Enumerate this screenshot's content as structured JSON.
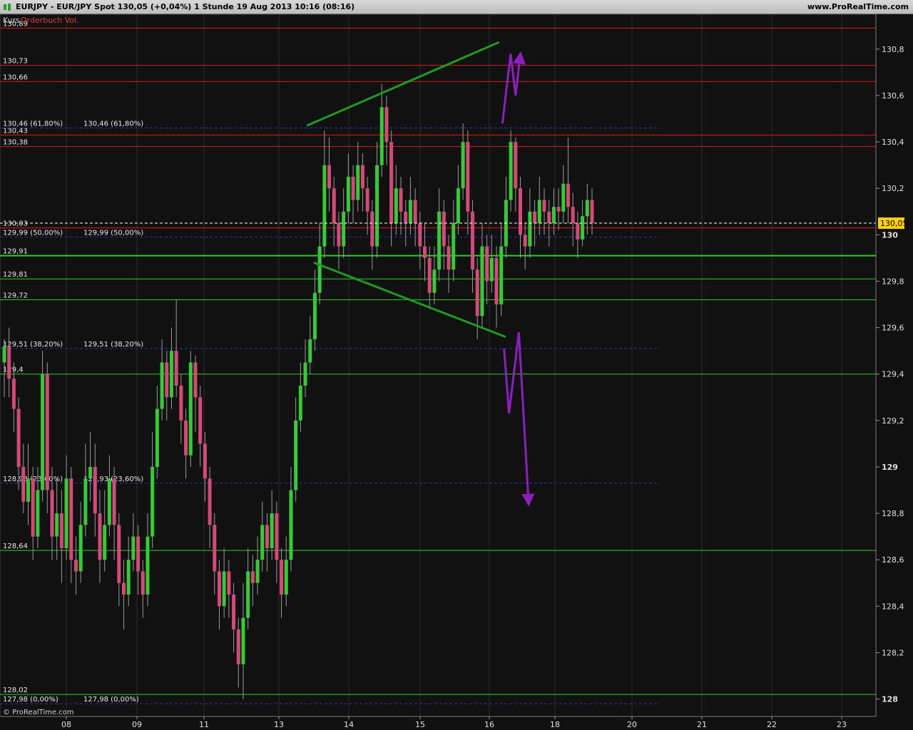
{
  "window": {
    "title": "EURJPY - EUR/JPY Spot     130,05 (+0,04%)     1 Stunde   19 Aug 2013 10:16 (08:16)",
    "site": "www.ProRealTime.com",
    "copyright": "© ProRealTime.com"
  },
  "legend": {
    "kurs": "Kurs",
    "orderbuch": "Orderbuch Vol."
  },
  "colors": {
    "background": "#111111",
    "bull_candle": "#33cc33",
    "bear_candle": "#d6487a",
    "resistance": "#d91c1c",
    "support": "#2dcc2d",
    "fib": "#2a35b8",
    "trend": "#1f9a1f",
    "forecast": "#8b1fc0",
    "price_badge": "#ffd000"
  },
  "chart_data": {
    "type": "candlestick",
    "symbol": "EURJPY",
    "timeframe": "1 Stunde",
    "last_price": 130.05,
    "last_price_label": "130,05",
    "change_pct": "+0,04%",
    "ylim": [
      127.925,
      130.95
    ],
    "y_ticks": [
      {
        "v": 130.8,
        "label": "130,8"
      },
      {
        "v": 130.6,
        "label": "130,6"
      },
      {
        "v": 130.4,
        "label": "130,4"
      },
      {
        "v": 130.2,
        "label": "130,2"
      },
      {
        "v": 130.0,
        "label": "130",
        "bold": true
      },
      {
        "v": 129.8,
        "label": "129,8"
      },
      {
        "v": 129.6,
        "label": "129,6"
      },
      {
        "v": 129.4,
        "label": "129,4"
      },
      {
        "v": 129.2,
        "label": "129,2"
      },
      {
        "v": 129.0,
        "label": "129",
        "bold": true
      },
      {
        "v": 128.8,
        "label": "128,8"
      },
      {
        "v": 128.6,
        "label": "128,6"
      },
      {
        "v": 128.4,
        "label": "128,4"
      },
      {
        "v": 128.2,
        "label": "128,2"
      },
      {
        "v": 128.0,
        "label": "128",
        "bold": true
      }
    ],
    "x_ticks": [
      "08",
      "09",
      "11",
      "13",
      "14",
      "15",
      "16",
      "18",
      "20",
      "21",
      "22",
      "23"
    ],
    "horizontal_levels": [
      {
        "value": 130.89,
        "label": "130,89",
        "kind": "resistance"
      },
      {
        "value": 130.73,
        "label": "130,73",
        "kind": "resistance"
      },
      {
        "value": 130.66,
        "label": "130,66",
        "kind": "resistance"
      },
      {
        "value": 130.43,
        "label": "130,43",
        "kind": "resistance"
      },
      {
        "value": 130.38,
        "label": "130,38",
        "kind": "resistance"
      },
      {
        "value": 130.03,
        "label": "130,03",
        "kind": "resistance"
      },
      {
        "value": 129.91,
        "label": "129,91",
        "kind": "support",
        "bold": true
      },
      {
        "value": 129.81,
        "label": "129,81",
        "kind": "support"
      },
      {
        "value": 129.72,
        "label": "129,72",
        "kind": "support"
      },
      {
        "value": 129.4,
        "label": "129,4",
        "kind": "support"
      },
      {
        "value": 128.64,
        "label": "128,64",
        "kind": "support"
      },
      {
        "value": 128.02,
        "label": "128,02",
        "kind": "support"
      }
    ],
    "fibonacci": [
      {
        "value": 130.46,
        "label": "130,46 (61,80%)"
      },
      {
        "value": 129.99,
        "label": "129,99 (50,00%)"
      },
      {
        "value": 129.51,
        "label": "129,51 (38,20%)"
      },
      {
        "value": 128.93,
        "label": "128,93 (23,60%)"
      },
      {
        "value": 127.98,
        "label": "127,98 (0,00%)"
      }
    ],
    "candles": [
      [
        129.45,
        129.52,
        129.55,
        129.3
      ],
      [
        129.52,
        129.38,
        129.6,
        129.3
      ],
      [
        129.38,
        129.25,
        129.45,
        129.15
      ],
      [
        129.25,
        129.0,
        129.3,
        128.9
      ],
      [
        129.0,
        128.85,
        129.1,
        128.8
      ],
      [
        128.85,
        128.95,
        129.1,
        128.75
      ],
      [
        128.95,
        128.7,
        129.0,
        128.6
      ],
      [
        128.7,
        128.9,
        129.0,
        128.65
      ],
      [
        128.9,
        129.4,
        129.5,
        128.85
      ],
      [
        129.4,
        128.9,
        129.45,
        128.8
      ],
      [
        128.9,
        128.7,
        129.0,
        128.6
      ],
      [
        128.7,
        128.8,
        128.95,
        128.6
      ],
      [
        128.8,
        128.65,
        128.9,
        128.5
      ],
      [
        128.65,
        128.95,
        129.05,
        128.6
      ],
      [
        128.95,
        128.6,
        129.0,
        128.5
      ],
      [
        128.6,
        128.55,
        128.7,
        128.45
      ],
      [
        128.55,
        128.75,
        128.85,
        128.5
      ],
      [
        128.75,
        128.95,
        129.1,
        128.7
      ],
      [
        128.95,
        129.0,
        129.15,
        128.85
      ],
      [
        129.0,
        128.8,
        129.1,
        128.7
      ],
      [
        128.8,
        128.6,
        128.9,
        128.5
      ],
      [
        128.6,
        128.75,
        128.9,
        128.55
      ],
      [
        128.75,
        128.95,
        129.05,
        128.7
      ],
      [
        128.95,
        128.75,
        129.0,
        128.6
      ],
      [
        128.75,
        128.5,
        128.8,
        128.4
      ],
      [
        128.5,
        128.45,
        128.6,
        128.3
      ],
      [
        128.45,
        128.6,
        128.7,
        128.4
      ],
      [
        128.6,
        128.7,
        128.8,
        128.55
      ],
      [
        128.7,
        128.55,
        128.75,
        128.45
      ],
      [
        128.55,
        128.45,
        128.6,
        128.35
      ],
      [
        128.45,
        128.7,
        128.8,
        128.4
      ],
      [
        128.7,
        129.0,
        129.15,
        128.65
      ],
      [
        129.0,
        129.25,
        129.35,
        128.95
      ],
      [
        129.25,
        129.45,
        129.55,
        129.2
      ],
      [
        129.45,
        129.3,
        129.5,
        129.2
      ],
      [
        129.3,
        129.5,
        129.6,
        129.25
      ],
      [
        129.5,
        129.35,
        129.72,
        129.3
      ],
      [
        129.35,
        129.2,
        129.4,
        129.1
      ],
      [
        129.2,
        129.05,
        129.25,
        128.95
      ],
      [
        129.05,
        129.45,
        129.5,
        129.0
      ],
      [
        129.45,
        129.3,
        129.48,
        129.15
      ],
      [
        129.3,
        129.1,
        129.35,
        129.0
      ],
      [
        129.1,
        128.95,
        129.15,
        128.85
      ],
      [
        128.95,
        128.75,
        129.0,
        128.65
      ],
      [
        128.75,
        128.55,
        128.8,
        128.45
      ],
      [
        128.55,
        128.4,
        128.6,
        128.3
      ],
      [
        128.4,
        128.55,
        128.65,
        128.35
      ],
      [
        128.55,
        128.45,
        128.6,
        128.35
      ],
      [
        128.45,
        128.3,
        128.5,
        128.2
      ],
      [
        128.3,
        128.15,
        128.35,
        128.05
      ],
      [
        128.15,
        128.35,
        128.5,
        128.0
      ],
      [
        128.35,
        128.55,
        128.65,
        128.3
      ],
      [
        128.55,
        128.5,
        128.62,
        128.4
      ],
      [
        128.5,
        128.6,
        128.7,
        128.45
      ],
      [
        128.6,
        128.75,
        128.85,
        128.55
      ],
      [
        128.75,
        128.65,
        128.8,
        128.55
      ],
      [
        128.65,
        128.8,
        128.9,
        128.6
      ],
      [
        128.8,
        128.6,
        128.85,
        128.5
      ],
      [
        128.6,
        128.45,
        128.65,
        128.35
      ],
      [
        128.45,
        128.6,
        128.7,
        128.4
      ],
      [
        128.6,
        128.9,
        129.0,
        128.55
      ],
      [
        128.9,
        129.2,
        129.3,
        128.85
      ],
      [
        129.2,
        129.35,
        129.45,
        129.15
      ],
      [
        129.35,
        129.45,
        129.55,
        129.3
      ],
      [
        129.45,
        129.55,
        129.65,
        129.4
      ],
      [
        129.55,
        129.75,
        129.85,
        129.5
      ],
      [
        129.75,
        129.95,
        130.05,
        129.7
      ],
      [
        129.95,
        130.3,
        130.45,
        129.9
      ],
      [
        130.3,
        130.2,
        130.42,
        130.1
      ],
      [
        130.2,
        130.05,
        130.25,
        129.95
      ],
      [
        130.05,
        129.95,
        130.1,
        129.85
      ],
      [
        129.95,
        130.1,
        130.2,
        129.9
      ],
      [
        130.1,
        130.25,
        130.35,
        130.05
      ],
      [
        130.25,
        130.15,
        130.3,
        130.05
      ],
      [
        130.15,
        130.3,
        130.4,
        130.1
      ],
      [
        130.3,
        130.2,
        130.35,
        130.1
      ],
      [
        130.2,
        130.1,
        130.25,
        130.0
      ],
      [
        130.1,
        129.95,
        130.15,
        129.85
      ],
      [
        129.95,
        130.3,
        130.4,
        129.9
      ],
      [
        130.3,
        130.55,
        130.65,
        130.25
      ],
      [
        130.55,
        130.4,
        130.6,
        130.3
      ],
      [
        130.4,
        130.05,
        130.45,
        129.95
      ],
      [
        130.05,
        130.2,
        130.3,
        130.0
      ],
      [
        130.2,
        130.1,
        130.25,
        130.0
      ],
      [
        130.1,
        130.05,
        130.15,
        129.95
      ],
      [
        130.05,
        130.15,
        130.25,
        130.0
      ],
      [
        130.15,
        130.05,
        130.2,
        129.95
      ],
      [
        130.05,
        129.95,
        130.1,
        129.85
      ],
      [
        129.95,
        129.9,
        130.05,
        129.8
      ],
      [
        129.9,
        129.75,
        129.95,
        129.68
      ],
      [
        129.75,
        129.85,
        129.95,
        129.7
      ],
      [
        129.85,
        130.1,
        130.2,
        129.8
      ],
      [
        130.1,
        129.95,
        130.15,
        129.85
      ],
      [
        129.95,
        129.85,
        130.0,
        129.75
      ],
      [
        129.85,
        130.05,
        130.15,
        129.8
      ],
      [
        130.05,
        130.2,
        130.3,
        130.0
      ],
      [
        130.2,
        130.4,
        130.48,
        130.15
      ],
      [
        130.4,
        130.1,
        130.45,
        130.0
      ],
      [
        130.1,
        129.85,
        130.15,
        129.75
      ],
      [
        129.85,
        129.65,
        129.9,
        129.55
      ],
      [
        129.65,
        129.95,
        130.05,
        129.6
      ],
      [
        129.95,
        129.8,
        130.0,
        129.7
      ],
      [
        129.8,
        129.9,
        130.0,
        129.75
      ],
      [
        129.9,
        129.7,
        129.95,
        129.6
      ],
      [
        129.7,
        129.95,
        130.05,
        129.65
      ],
      [
        129.95,
        130.15,
        130.25,
        129.9
      ],
      [
        130.15,
        130.4,
        130.45,
        130.1
      ],
      [
        130.4,
        130.2,
        130.42,
        130.1
      ],
      [
        130.2,
        130.0,
        130.25,
        129.9
      ],
      [
        130.0,
        129.95,
        130.05,
        129.85
      ],
      [
        129.95,
        130.1,
        130.2,
        129.9
      ],
      [
        130.1,
        130.05,
        130.15,
        129.95
      ],
      [
        130.05,
        130.15,
        130.25,
        130.0
      ],
      [
        130.15,
        130.1,
        130.2,
        130.0
      ],
      [
        130.1,
        130.05,
        130.15,
        129.95
      ],
      [
        130.05,
        130.12,
        130.2,
        130.0
      ],
      [
        130.12,
        130.1,
        130.2,
        130.02
      ],
      [
        130.1,
        130.22,
        130.3,
        130.05
      ],
      [
        130.22,
        130.12,
        130.42,
        130.05
      ],
      [
        130.12,
        130.05,
        130.18,
        129.95
      ],
      [
        130.05,
        129.98,
        130.1,
        129.9
      ],
      [
        129.98,
        130.08,
        130.15,
        129.95
      ],
      [
        130.08,
        130.15,
        130.22,
        130.0
      ],
      [
        130.15,
        130.05,
        130.2,
        130.0
      ]
    ],
    "trendlines": [
      {
        "label": "upper",
        "from": [
          13.4,
          130.47
        ],
        "to": [
          16.3,
          130.83
        ]
      },
      {
        "label": "lower",
        "from": [
          13.5,
          129.88
        ],
        "to": [
          16.5,
          129.56
        ]
      }
    ],
    "forecast_paths": [
      {
        "label": "bullish",
        "points": [
          [
            16.4,
            130.48
          ],
          [
            16.65,
            130.78
          ],
          [
            16.8,
            130.6
          ],
          [
            16.95,
            130.78
          ]
        ]
      },
      {
        "label": "bearish",
        "points": [
          [
            16.45,
            129.51
          ],
          [
            16.6,
            129.23
          ],
          [
            16.9,
            129.58
          ],
          [
            17.2,
            128.84
          ]
        ]
      }
    ]
  }
}
